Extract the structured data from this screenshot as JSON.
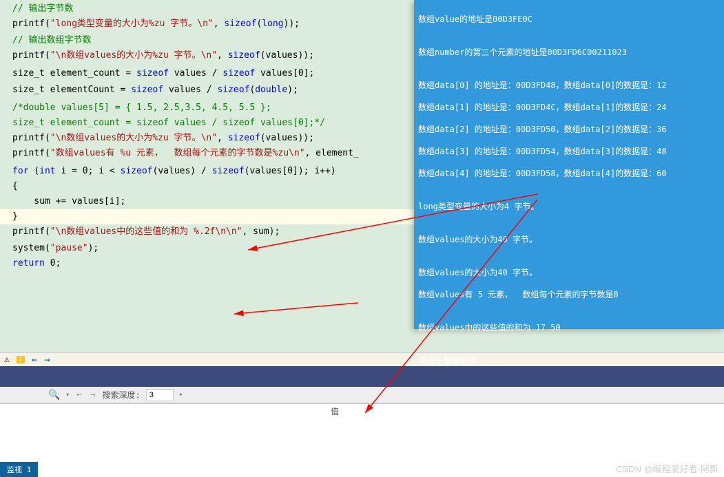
{
  "code": {
    "l1": "// 输出字节数",
    "l2a": "printf(",
    "l2b": "\"long类型变量的大小为%zu 字节。",
    "l2c": "\\n",
    "l2d": "\"",
    "l2e": ", ",
    "l2f": "sizeof",
    "l2g": "(",
    "l2h": "long",
    "l2i": "));",
    "l3": "",
    "l4": "// 输出数组字节数",
    "l5a": "printf(",
    "l5b": "\"",
    "l5c": "\\n",
    "l5d": "数组values的大小为%zu 字节。",
    "l5e": "\\n",
    "l5f": "\"",
    "l5g": ", ",
    "l5h": "sizeof",
    "l5i": "(values));",
    "l6": "",
    "l7": "",
    "l8a": "size_t element_count = ",
    "l8b": "sizeof",
    "l8c": " values / ",
    "l8d": "sizeof",
    "l8e": " values[0];",
    "l9": "",
    "l10a": "size_t elementCount = ",
    "l10b": "sizeof",
    "l10c": " values / ",
    "l10d": "sizeof",
    "l10e": "(",
    "l10f": "double",
    "l10g": ");",
    "l11": "",
    "l12": "",
    "l13": "/*double values[5] = { 1.5, 2.5,3.5, 4.5, 5.5 };",
    "l14": "size_t element_count = sizeof values / sizeof values[0];*/",
    "l15a": "printf(",
    "l15b": "\"",
    "l15c": "\\n",
    "l15d": "数组values的大小为%zu 字节。",
    "l15e": "\\n",
    "l15f": "\"",
    "l15g": ", ",
    "l15h": "sizeof",
    "l15i": "(values));",
    "l16a": "printf(",
    "l16b": "\"数组values有 %u 元素，  数组每个元素的字节数是%zu",
    "l16c": "\\n",
    "l16d": "\"",
    "l16e": ", element_",
    "l17": "",
    "l18": "",
    "l19a": "for",
    "l19b": " (",
    "l19c": "int",
    "l19d": " i = 0; i < ",
    "l19e": "sizeof",
    "l19f": "(values) / ",
    "l19g": "sizeof",
    "l19h": "(values[0]); i++)",
    "l20": "{",
    "l21": "    sum += values[i];",
    "l22": "}",
    "l23a": "printf(",
    "l23b": "\"",
    "l23c": "\\n",
    "l23d": "数组values中的这些值的和为 %.2f",
    "l23e": "\\n\\n",
    "l23f": "\"",
    "l23g": ", sum);",
    "l24": "",
    "l25a": "system(",
    "l25b": "\"pause\"",
    "l25c": ");",
    "l26a": "return",
    "l26b": " 0;"
  },
  "console": {
    "l1": "数组value的地址是00D3FE0C",
    "l2": "",
    "l3": "数组number的第三个元素的地址是00D3FD6C00211023",
    "l4": "",
    "l5": "数组data[0] 的地址是：00D3FD48，数组data[0]的数据是：12",
    "l6": "数组data[1] 的地址是：00D3FD4C，数组data[1]的数据是：24",
    "l7": "数组data[2] 的地址是：00D3FD50，数组data[2]的数据是：36",
    "l8": "数组data[3] 的地址是：00D3FD54，数组data[3]的数据是：48",
    "l9": "数组data[4] 的地址是：00D3FD58，数组data[4]的数据是：60",
    "l10": "",
    "l11": "long类型变量的大小为4 字节。",
    "l12": "",
    "l13": "数组values的大小为40 字节。",
    "l14": "",
    "l15": "数组values的大小为40 字节。",
    "l16": "数组values有 5 元素，  数组每个元素的字节数是8",
    "l17": "",
    "l18": "数组values中的这些值的和为 17.50",
    "l19": "",
    "l20": "请按任意键继续. . ."
  },
  "status": {
    "warn_count": "1"
  },
  "search": {
    "depth_label": "搜索深度:",
    "depth_value": "3"
  },
  "headers": {
    "value": "值"
  },
  "tabs": {
    "watch": "监视 1"
  },
  "watermark": "CSDN @编程爱好者-阿新"
}
